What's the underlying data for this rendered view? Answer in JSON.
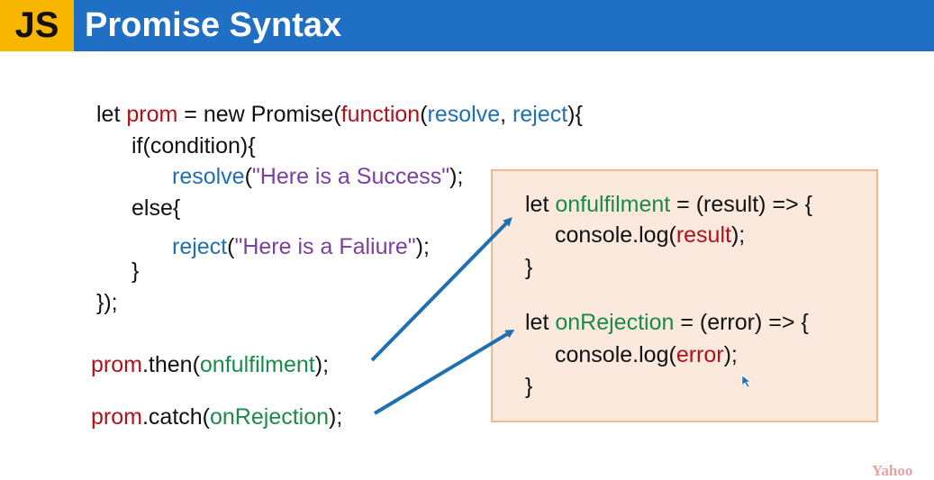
{
  "header": {
    "logo": "JS",
    "title": "Promise Syntax"
  },
  "code": {
    "l1": {
      "a": "let ",
      "b": "prom",
      "c": " = new Promise(",
      "d": "function",
      "e": "(",
      "f": "resolve",
      "g": ", ",
      "h": "reject",
      "i": "){"
    },
    "l2": "if(condition){",
    "l3": {
      "a": "resolve",
      "b": "(",
      "c": "\"Here is a Success\"",
      "d": ");"
    },
    "l4": "else{",
    "l5": {
      "a": "reject",
      "b": "(",
      "c": "\"Here is a Faliure\"",
      "d": ");"
    },
    "l6": "}",
    "l7": "});",
    "then": {
      "a": "prom",
      "b": ".then(",
      "c": "onfulfilment",
      "d": ");"
    },
    "catch": {
      "a": "prom",
      "b": ".catch(",
      "c": "onRejection",
      "d": ");"
    }
  },
  "box": {
    "b1": {
      "a": "let ",
      "b": "onfulfilment",
      "c": " = (result) => {"
    },
    "b2": {
      "a": "console.log(",
      "b": "result",
      "c": ");"
    },
    "b3": "}",
    "b4": {
      "a": "let ",
      "b": "onRejection",
      "c": " = (error) => {"
    },
    "b5": {
      "a": "console.log(",
      "b": "error",
      "c": ");"
    },
    "b6": "}"
  },
  "watermark": "Yahoo",
  "colors": {
    "header": "#1f6fc4",
    "logo": "#f7b500",
    "arrow": "#1f6fb3",
    "box": "#fbe9de"
  }
}
